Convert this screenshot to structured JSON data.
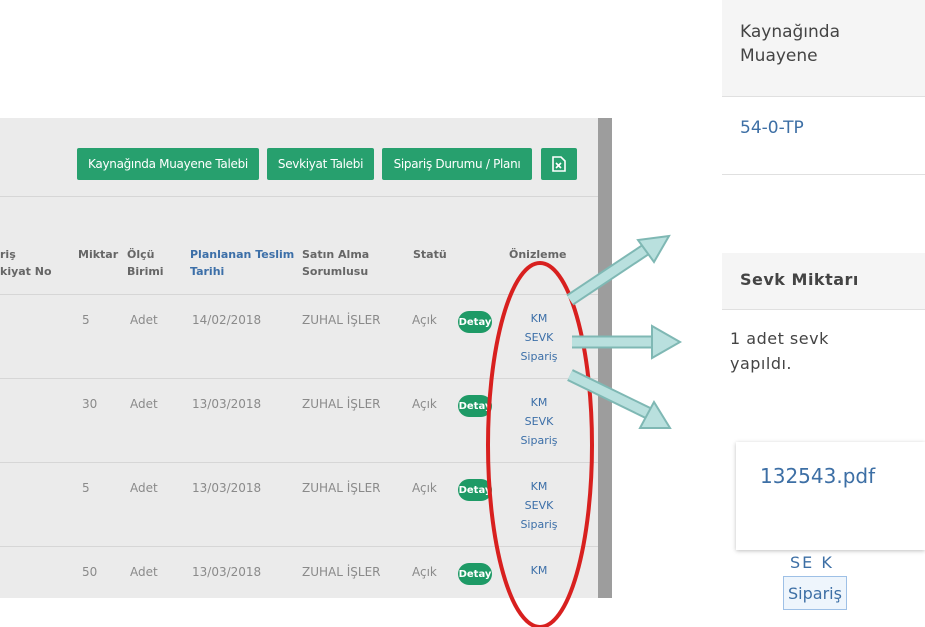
{
  "toolbar": {
    "btn_inspection": "Kaynağında Muayene Talebi",
    "btn_shipment": "Sevkiyat Talebi",
    "btn_status": "Sipariş Durumu / Planı",
    "btn_export_icon": "excel-export-icon"
  },
  "table": {
    "headers": {
      "col1_line1": "riş",
      "col1_line2": "kiyat No",
      "qty": "Miktar",
      "unit_line1": "Ölçü",
      "unit_line2": "Birimi",
      "date_line1": "Planlanan Teslim",
      "date_line2": "Tarihi",
      "buyer_line1": "Satın Alma",
      "buyer_line2": "Sorumlusu",
      "status": "Statü",
      "preview": "Önizleme"
    },
    "rows": [
      {
        "qty": "5",
        "unit": "Adet",
        "date": "14/02/2018",
        "buyer": "ZUHAL İŞLER",
        "status": "Açık",
        "detail": "Detay",
        "link1": "KM",
        "link2": "SEVK",
        "link3": "Sipariş"
      },
      {
        "qty": "30",
        "unit": "Adet",
        "date": "13/03/2018",
        "buyer": "ZUHAL İŞLER",
        "status": "Açık",
        "detail": "Detay",
        "link1": "KM",
        "link2": "SEVK",
        "link3": "Sipariş"
      },
      {
        "qty": "5",
        "unit": "Adet",
        "date": "13/03/2018",
        "buyer": "ZUHAL İŞLER",
        "status": "Açık",
        "detail": "Detay",
        "link1": "KM",
        "link2": "SEVK",
        "link3": "Sipariş"
      },
      {
        "qty": "50",
        "unit": "Adet",
        "date": "13/03/2018",
        "buyer": "ZUHAL İŞLER",
        "status": "Açık",
        "detail": "Detay",
        "link1": "KM",
        "link2": "",
        "link3": ""
      }
    ]
  },
  "callouts": {
    "inspection_title": "Kaynağında Muayene",
    "inspection_value": "54-0-TP",
    "shipment_title": "Sevk Miktarı",
    "shipment_text": "1 adet sevk yapıldı.",
    "pdf_link": "132543.pdf",
    "fragment_sevk": "SE K",
    "fragment_siparis": "Sipariş"
  },
  "colors": {
    "button_green": "#27a06e",
    "link_blue": "#3c6fa8",
    "arrow_fill": "#a9d5d3",
    "ellipse_red": "#d8201f"
  }
}
